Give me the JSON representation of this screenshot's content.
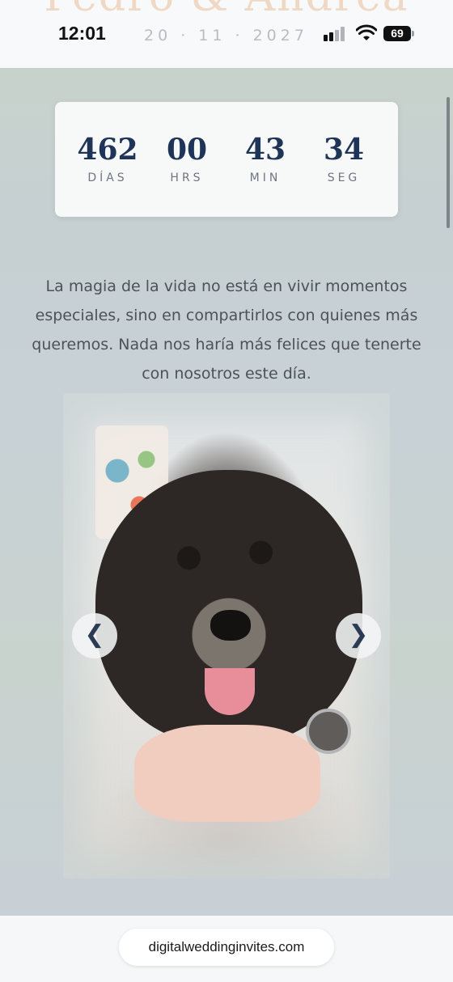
{
  "header": {
    "couple_title": "Pedro & Andrea",
    "time": "12:01",
    "date": "20 · 11 · 2027",
    "battery": "69"
  },
  "countdown": {
    "items": [
      {
        "value": "462",
        "label": "DÍAS"
      },
      {
        "value": "00",
        "label": "HRS"
      },
      {
        "value": "43",
        "label": "MIN"
      },
      {
        "value": "34",
        "label": "SEG"
      }
    ]
  },
  "message": "La magia de la vida no está en vivir momentos especiales, sino en compartirlos con quienes más queremos. Nada nos haría más felices que tenerte con nosotros este día.",
  "carousel": {
    "prev_symbol": "❮",
    "next_symbol": "❯"
  },
  "browser": {
    "url": "digitalweddinginvites.com"
  },
  "colors": {
    "accent": "#1f3558",
    "title": "#efd9c4"
  }
}
